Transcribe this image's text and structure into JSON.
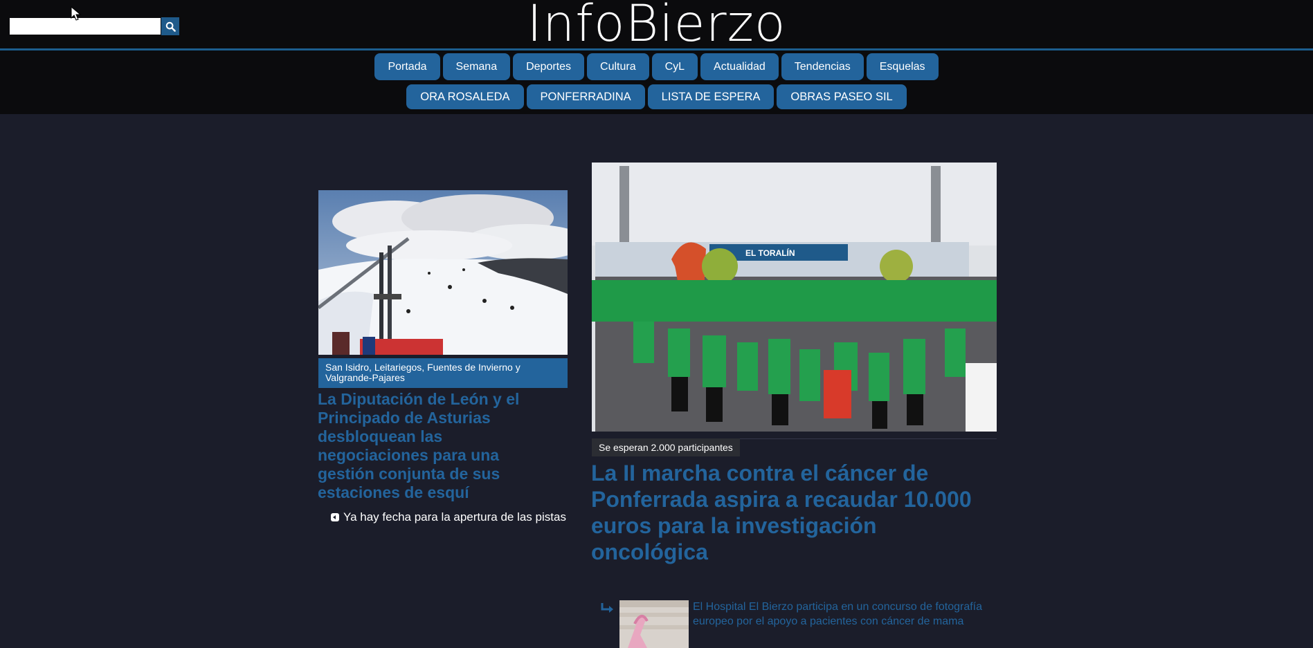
{
  "brand": {
    "logo_text": "InfoBierzo"
  },
  "search": {
    "value": "",
    "placeholder": ""
  },
  "nav": {
    "primary": [
      "Portada",
      "Semana",
      "Deportes",
      "Cultura",
      "CyL",
      "Actualidad",
      "Tendencias",
      "Esquelas"
    ],
    "secondary": [
      "ORA ROSALEDA",
      "PONFERRADINA",
      "LISTA DE ESPERA",
      "OBRAS PASEO SIL"
    ]
  },
  "left_article": {
    "caption": "San Isidro, Leitariegos, Fuentes de Invierno y Valgrande-Pajares",
    "title": "La Diputación de León y el Principado de Asturias desbloquean las negociaciones para una gestión conjunta de sus estaciones de esquí",
    "related": "Ya hay fecha para la apertura de las pistas"
  },
  "right_article": {
    "caption": "Se esperan 2.000 participantes",
    "title": "La II marcha contra el cáncer de Ponferrada aspira a recaudar 10.000 euros para la investigación oncológica",
    "related": "El Hospital El Bierzo participa en un concurso de fotografía europeo por el apoyo a pacientes con cáncer de mama",
    "stadium_sign": "EL TORALÍN"
  },
  "colors": {
    "accent": "#23649c",
    "background": "#1b1d2a",
    "header": "#0b0b0d"
  }
}
